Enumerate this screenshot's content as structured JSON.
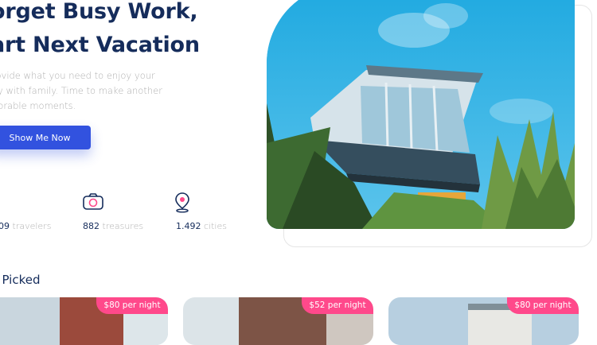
{
  "hero": {
    "title_line1": "orget Busy Work,",
    "title_line2": "art Next Vacation",
    "description_line1": "rovide what you need to enjoy your",
    "description_line2": "ay with family. Time to make another",
    "description_line3": "norable moments.",
    "cta_label": "Show Me Now"
  },
  "stats": [
    {
      "value": "09",
      "unit": "travelers",
      "icon": "traveler-icon"
    },
    {
      "value": "882",
      "unit": "treasures",
      "icon": "camera-icon"
    },
    {
      "value": "1.492",
      "unit": "cities",
      "icon": "map-pin-icon"
    }
  ],
  "section": {
    "title": "st Picked"
  },
  "cards": [
    {
      "price": "$80 per night"
    },
    {
      "price": "$52 per night"
    },
    {
      "price": "$80 per night"
    }
  ],
  "colors": {
    "primary": "#3252DF",
    "heading": "#152C5B",
    "muted": "#B0B0B0",
    "badge": "#FF498B"
  }
}
